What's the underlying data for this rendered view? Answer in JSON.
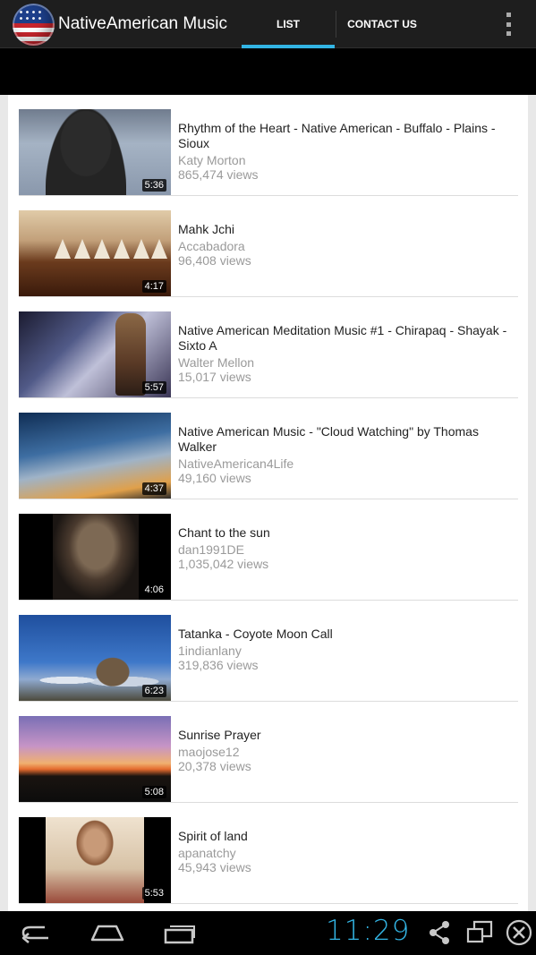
{
  "app": {
    "title": "NativeAmerican Music",
    "logo_icon": "us-flag-globe-icon"
  },
  "tabs": [
    {
      "label": "LIST",
      "selected": true
    },
    {
      "label": "CONTACT US",
      "selected": false
    }
  ],
  "accent_color": "#33b5e5",
  "videos": [
    {
      "title": "Rhythm of the Heart - Native American - Buffalo - Plains - Sioux",
      "channel": "Katy Morton",
      "views": "865,474 views",
      "duration": "5:36"
    },
    {
      "title": "Mahk Jchi",
      "channel": "Accabadora",
      "views": "96,408 views",
      "duration": "4:17"
    },
    {
      "title": "Native American Meditation Music #1 - Chirapaq - Shayak - Sixto A",
      "channel": "Walter Mellon",
      "views": "15,017 views",
      "duration": "5:57"
    },
    {
      "title": "Native American Music - \"Cloud Watching\" by Thomas Walker",
      "channel": "NativeAmerican4Life",
      "views": "49,160 views",
      "duration": "4:37"
    },
    {
      "title": "Chant to the sun",
      "channel": "dan1991DE",
      "views": "1,035,042 views",
      "duration": "4:06"
    },
    {
      "title": "Tatanka - Coyote Moon Call",
      "channel": "1indianlany",
      "views": "319,836 views",
      "duration": "6:23"
    },
    {
      "title": "Sunrise Prayer",
      "channel": "maojose12",
      "views": "20,378 views",
      "duration": "5:08"
    },
    {
      "title": "Spirit of land",
      "channel": "apanatchy",
      "views": "45,943 views",
      "duration": "5:53"
    }
  ],
  "status_bar": {
    "time": "11:29"
  }
}
